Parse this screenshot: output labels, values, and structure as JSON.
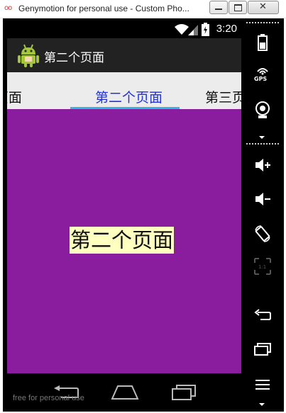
{
  "window": {
    "logo_text": "oo",
    "title": "Genymotion for personal use - Custom Pho...",
    "close_glyph": "✕"
  },
  "status_bar": {
    "time": "3:20"
  },
  "action_bar": {
    "title": "第二个页面"
  },
  "tabs": [
    {
      "label": "第一个页面",
      "display": "-页面"
    },
    {
      "label": "第二个页面",
      "display": "第二个页面",
      "selected": true
    },
    {
      "label": "第三个页面",
      "display": "第三页"
    }
  ],
  "content": {
    "heading": "第二个页面"
  },
  "navbar": {
    "watermark": "free for personal use"
  },
  "sidebar": {
    "gps_label": "GPS",
    "icons": [
      "battery-icon",
      "gps-icon",
      "camera-icon",
      "volume-up-icon",
      "volume-down-icon",
      "rotate-icon",
      "scale-icon",
      "back-icon",
      "recent-apps-icon",
      "menu-icon"
    ]
  },
  "colors": {
    "page_background": "#8a1d9d",
    "heading_highlight": "#ffffc0",
    "selected_tab_text": "#2233dd",
    "tab_indicator": "#33b5e5",
    "action_bar": "#222222"
  }
}
